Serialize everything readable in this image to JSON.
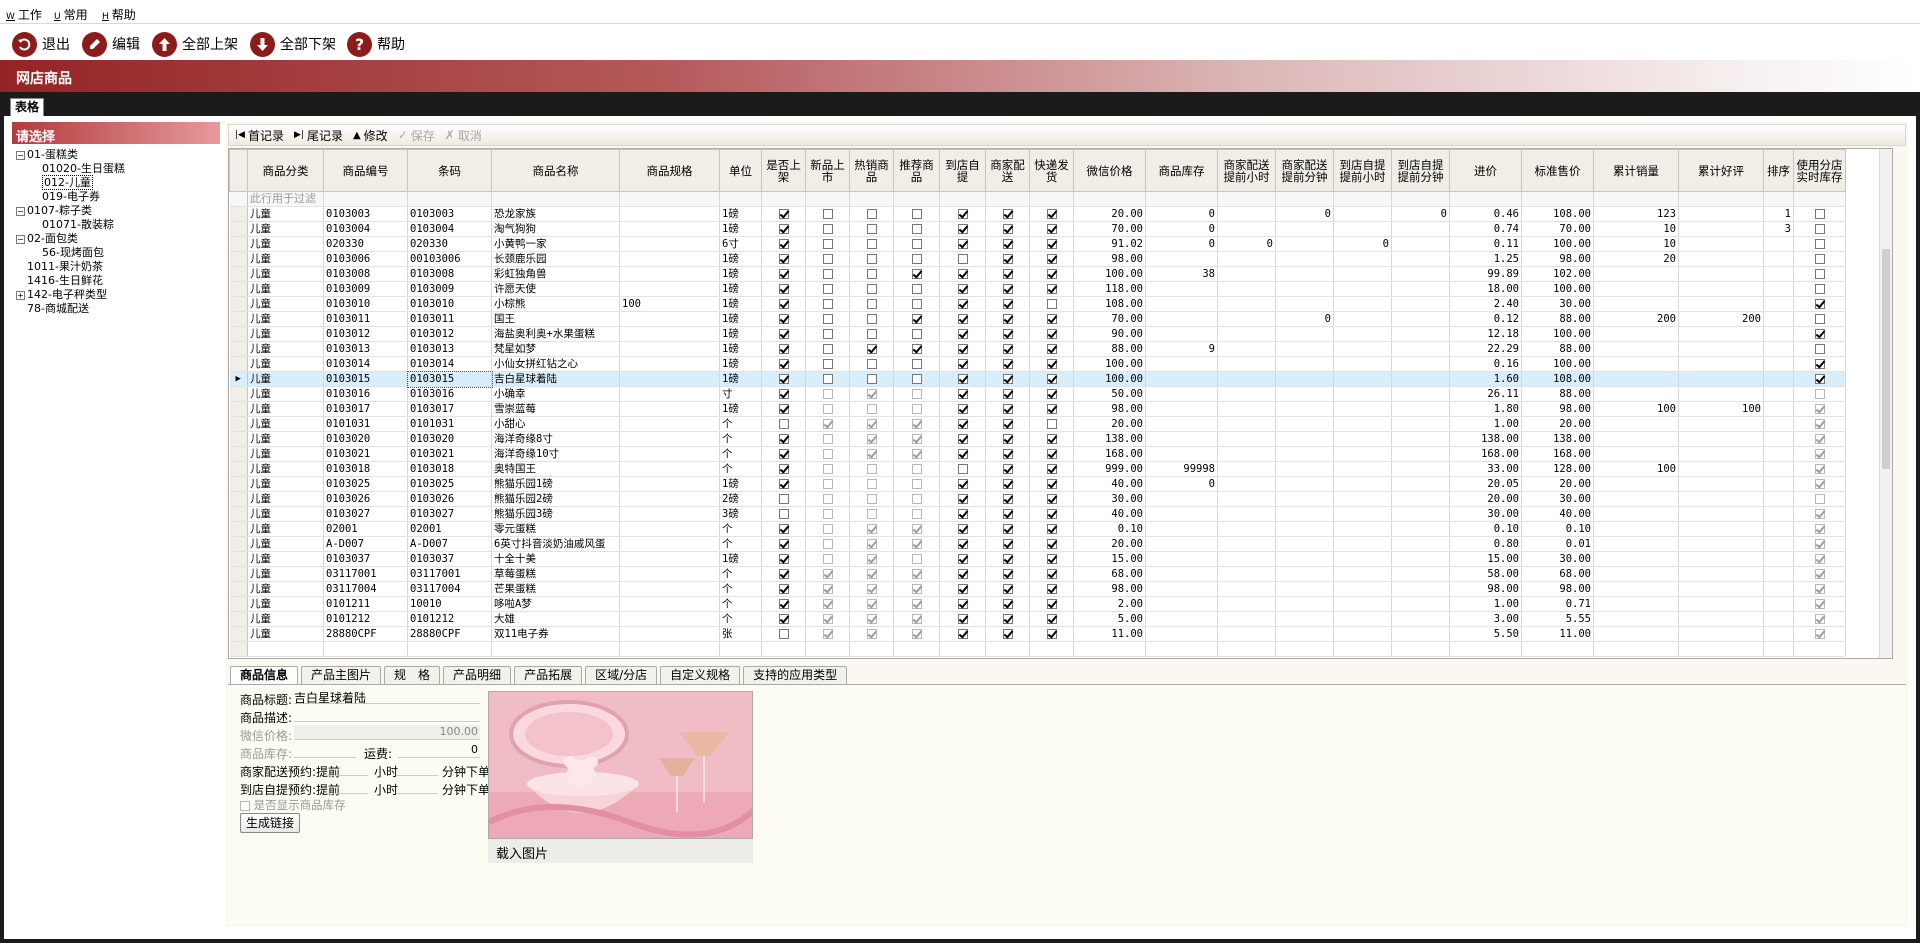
{
  "menu": [
    {
      "key": "W",
      "label": "工作"
    },
    {
      "key": "U",
      "label": "常用"
    },
    {
      "key": "H",
      "label": "帮助"
    }
  ],
  "toolbar": {
    "exit": "退出",
    "edit": "编辑",
    "all_up": "全部上架",
    "all_down": "全部下架",
    "help": "帮助"
  },
  "page_title": "网店商品",
  "view_tab": "表格",
  "tree": {
    "header": "请选择",
    "nodes": [
      {
        "label": "01-蛋糕类",
        "level": 0,
        "expander": "−"
      },
      {
        "label": "01020-生日蛋糕",
        "level": 1
      },
      {
        "label": "012-儿童",
        "level": 1,
        "selected": true
      },
      {
        "label": "019-电子券",
        "level": 1
      },
      {
        "label": "0107-粽子类",
        "level": 0,
        "expander": "−"
      },
      {
        "label": "01071-散装粽",
        "level": 1
      },
      {
        "label": "02-面包类",
        "level": 0,
        "expander": "−"
      },
      {
        "label": "56-现烤面包",
        "level": 1
      },
      {
        "label": "1011-果汁奶茶",
        "level": 0
      },
      {
        "label": "1416-生日鲜花",
        "level": 0
      },
      {
        "label": "142-电子秤类型",
        "level": 0,
        "expander": "+"
      },
      {
        "label": "78-商城配送",
        "level": 0
      }
    ]
  },
  "grid_toolbar": {
    "first": "首记录",
    "last": "尾记录",
    "modify": "修改",
    "save": "保存",
    "cancel": "取消"
  },
  "grid": {
    "filter_hint": "此行用于过滤",
    "columns": [
      "商品分类",
      "商品编号",
      "条码",
      "商品名称",
      "商品规格",
      "单位",
      "是否上架",
      "新品上市",
      "热销商品",
      "推荐商品",
      "到店自提",
      "商家配送",
      "快递发货",
      "微信价格",
      "商品库存",
      "商家配送提前小时",
      "商家配送提前分钟",
      "到店自提提前小时",
      "到店自提提前分钟",
      "进价",
      "标准售价",
      "累计销量",
      "累计好评",
      "排序",
      "使用分店实时库存"
    ],
    "rows": [
      [
        "儿童",
        "0103003",
        "0103003",
        "恐龙家族",
        "",
        "1磅",
        1,
        0,
        0,
        0,
        1,
        1,
        1,
        "20.00",
        "0",
        "",
        "0",
        "",
        "0",
        "0.46",
        "108.00",
        "123",
        "",
        "1",
        0
      ],
      [
        "儿童",
        "0103004",
        "0103004",
        "淘气狗狗",
        "",
        "1磅",
        1,
        0,
        0,
        0,
        1,
        1,
        1,
        "70.00",
        "0",
        "",
        "",
        "",
        "",
        "0.74",
        "70.00",
        "10",
        "",
        "3",
        0
      ],
      [
        "儿童",
        "020330",
        "020330",
        "小黄鸭一家",
        "",
        "6寸",
        1,
        0,
        0,
        0,
        1,
        1,
        1,
        "91.02",
        "0",
        "0",
        "",
        "0",
        "",
        "0.11",
        "100.00",
        "10",
        "",
        "",
        0
      ],
      [
        "儿童",
        "0103006",
        "00103006",
        "长颈鹿乐园",
        "",
        "1磅",
        1,
        0,
        0,
        0,
        0,
        1,
        1,
        "98.00",
        "",
        "",
        "",
        "",
        "",
        "1.25",
        "98.00",
        "20",
        "",
        "",
        0
      ],
      [
        "儿童",
        "0103008",
        "0103008",
        "彩虹独角兽",
        "",
        "1磅",
        1,
        0,
        0,
        1,
        1,
        1,
        1,
        "100.00",
        "38",
        "",
        "",
        "",
        "",
        "99.89",
        "102.00",
        "",
        "",
        "",
        0
      ],
      [
        "儿童",
        "0103009",
        "0103009",
        "许愿天使",
        "",
        "1磅",
        1,
        0,
        0,
        0,
        1,
        1,
        1,
        "118.00",
        "",
        "",
        "",
        "",
        "",
        "18.00",
        "100.00",
        "",
        "",
        "",
        0
      ],
      [
        "儿童",
        "0103010",
        "0103010",
        "小棕熊",
        "100",
        "1磅",
        1,
        0,
        0,
        0,
        1,
        1,
        0,
        "108.00",
        "",
        "",
        "",
        "",
        "",
        "2.40",
        "30.00",
        "",
        "",
        "",
        1
      ],
      [
        "儿童",
        "0103011",
        "0103011",
        "国王",
        "",
        "1磅",
        1,
        0,
        0,
        1,
        1,
        1,
        1,
        "70.00",
        "",
        "",
        "0",
        "",
        "",
        "0.12",
        "88.00",
        "200",
        "200",
        "",
        0
      ],
      [
        "儿童",
        "0103012",
        "0103012",
        "海盐奥利奥+水果蛋糕",
        "",
        "1磅",
        1,
        0,
        0,
        0,
        1,
        1,
        1,
        "90.00",
        "",
        "",
        "",
        "",
        "",
        "12.18",
        "100.00",
        "",
        "",
        "",
        1
      ],
      [
        "儿童",
        "0103013",
        "0103013",
        "梵星如梦",
        "",
        "1磅",
        1,
        0,
        1,
        1,
        1,
        1,
        1,
        "88.00",
        "9",
        "",
        "",
        "",
        "",
        "22.29",
        "88.00",
        "",
        "",
        "",
        0
      ],
      [
        "儿童",
        "0103014",
        "0103014",
        "小仙女拼红钻之心",
        "",
        "1磅",
        1,
        0,
        0,
        0,
        1,
        1,
        1,
        "100.00",
        "",
        "",
        "",
        "",
        "",
        "0.16",
        "100.00",
        "",
        "",
        "",
        1
      ],
      [
        "儿童",
        "0103015",
        "0103015",
        "吉白星球着陆",
        "",
        "1磅",
        1,
        0,
        0,
        0,
        1,
        1,
        1,
        "100.00",
        "",
        "",
        "",
        "",
        "",
        "1.60",
        "108.00",
        "",
        "",
        "",
        1
      ],
      [
        "儿童",
        "0103016",
        "0103016",
        "小确幸",
        "",
        "寸",
        1,
        0,
        1,
        0,
        1,
        1,
        1,
        "50.00",
        "",
        "",
        "",
        "",
        "",
        "26.11",
        "88.00",
        "",
        "",
        "",
        0
      ],
      [
        "儿童",
        "0103017",
        "0103017",
        "雪崇蓝莓",
        "",
        "1磅",
        1,
        0,
        0,
        0,
        1,
        1,
        1,
        "98.00",
        "",
        "",
        "",
        "",
        "",
        "1.80",
        "98.00",
        "100",
        "100",
        "",
        1
      ],
      [
        "儿童",
        "0101031",
        "0101031",
        "小甜心",
        "",
        "个",
        0,
        1,
        1,
        1,
        1,
        1,
        0,
        "20.00",
        "",
        "",
        "",
        "",
        "",
        "1.00",
        "20.00",
        "",
        "",
        "",
        1
      ],
      [
        "儿童",
        "0103020",
        "0103020",
        "海洋奇缘8寸",
        "",
        "个",
        1,
        0,
        1,
        1,
        1,
        1,
        1,
        "138.00",
        "",
        "",
        "",
        "",
        "",
        "138.00",
        "138.00",
        "",
        "",
        "",
        1
      ],
      [
        "儿童",
        "0103021",
        "0103021",
        "海洋奇缘10寸",
        "",
        "个",
        1,
        0,
        1,
        1,
        1,
        1,
        1,
        "168.00",
        "",
        "",
        "",
        "",
        "",
        "168.00",
        "168.00",
        "",
        "",
        "",
        1
      ],
      [
        "儿童",
        "0103018",
        "0103018",
        "奥特国王",
        "",
        "个",
        1,
        0,
        0,
        0,
        0,
        1,
        1,
        "999.00",
        "99998",
        "",
        "",
        "",
        "",
        "33.00",
        "128.00",
        "100",
        "",
        "",
        1
      ],
      [
        "儿童",
        "0103025",
        "0103025",
        "熊猫乐园1磅",
        "",
        "1磅",
        1,
        0,
        0,
        0,
        1,
        1,
        1,
        "40.00",
        "0",
        "",
        "",
        "",
        "",
        "20.05",
        "20.00",
        "",
        "",
        "",
        1
      ],
      [
        "儿童",
        "0103026",
        "0103026",
        "熊猫乐园2磅",
        "",
        "2磅",
        0,
        0,
        0,
        0,
        1,
        1,
        1,
        "30.00",
        "",
        "",
        "",
        "",
        "",
        "20.00",
        "30.00",
        "",
        "",
        "",
        0
      ],
      [
        "儿童",
        "0103027",
        "0103027",
        "熊猫乐园3磅",
        "",
        "3磅",
        0,
        0,
        0,
        0,
        1,
        1,
        1,
        "40.00",
        "",
        "",
        "",
        "",
        "",
        "30.00",
        "40.00",
        "",
        "",
        "",
        1
      ],
      [
        "儿童",
        "02001",
        "02001",
        "零元蛋糕",
        "",
        "个",
        1,
        0,
        1,
        1,
        1,
        1,
        1,
        "0.10",
        "",
        "",
        "",
        "",
        "",
        "0.10",
        "0.10",
        "",
        "",
        "",
        1
      ],
      [
        "儿童",
        "A-D007",
        "A-D007",
        "6英寸抖音淡奶油戚风蛋",
        "",
        "个",
        1,
        0,
        1,
        1,
        1,
        1,
        1,
        "20.00",
        "",
        "",
        "",
        "",
        "",
        "0.80",
        "0.01",
        "",
        "",
        "",
        1
      ],
      [
        "儿童",
        "0103037",
        "0103037",
        "十全十美",
        "",
        "1磅",
        1,
        0,
        1,
        0,
        1,
        1,
        1,
        "15.00",
        "",
        "",
        "",
        "",
        "",
        "15.00",
        "30.00",
        "",
        "",
        "",
        1
      ],
      [
        "儿童",
        "03117001",
        "03117001",
        "草莓蛋糕",
        "",
        "个",
        1,
        1,
        1,
        1,
        1,
        1,
        1,
        "68.00",
        "",
        "",
        "",
        "",
        "",
        "58.00",
        "68.00",
        "",
        "",
        "",
        1
      ],
      [
        "儿童",
        "03117004",
        "03117004",
        "芒果蛋糕",
        "",
        "个",
        1,
        1,
        1,
        1,
        1,
        1,
        1,
        "98.00",
        "",
        "",
        "",
        "",
        "",
        "98.00",
        "98.00",
        "",
        "",
        "",
        1
      ],
      [
        "儿童",
        "0101211",
        "10010",
        "哆啦A梦",
        "",
        "个",
        1,
        1,
        1,
        1,
        1,
        1,
        1,
        "2.00",
        "",
        "",
        "",
        "",
        "",
        "1.00",
        "0.71",
        "",
        "",
        "",
        1
      ],
      [
        "儿童",
        "0101212",
        "0101212",
        "大雄",
        "",
        "个",
        1,
        1,
        1,
        1,
        1,
        1,
        1,
        "5.00",
        "",
        "",
        "",
        "",
        "",
        "3.00",
        "5.55",
        "",
        "",
        "",
        1
      ],
      [
        "儿童",
        "28880CPF",
        "28880CPF",
        "双11电子券",
        "",
        "张",
        0,
        1,
        1,
        1,
        1,
        1,
        1,
        "11.00",
        "",
        "",
        "",
        "",
        "",
        "5.50",
        "11.00",
        "",
        "",
        "",
        1
      ]
    ]
  },
  "detail_tabs": [
    "商品信息",
    "产品主图片",
    "规　格",
    "产品明细",
    "产品拓展",
    "区域/分店",
    "自定义规格",
    "支持的应用类型"
  ],
  "detail": {
    "title_label": "商品标题:",
    "title_value": "吉白星球着陆",
    "desc_label": "商品描述:",
    "wx_price_label": "微信价格:",
    "wx_price_value": "100.00",
    "stock_label": "商品库存:",
    "freight_label": "运费:",
    "freight_value": "0",
    "merchant_label": "商家配送预约:",
    "advance": "提前",
    "hours": "小时",
    "minutes": "分钟下单",
    "pickup_label": "到店自提预约:",
    "show_stock": "是否显示商品库存",
    "gen_link": "生成链接",
    "load_image": "载入图片"
  },
  "colors": {
    "accent": "#932426",
    "selected_row": "#d8eefa"
  }
}
